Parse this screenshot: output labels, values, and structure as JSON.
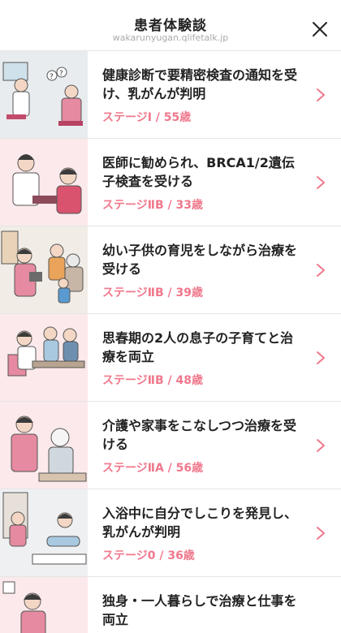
{
  "header": {
    "title": "患者体験談",
    "url": "wakarunyugan.qlifetalk.jp"
  },
  "icons": {
    "close": "close-icon",
    "chevron": "chevron-right-icon"
  },
  "colors": {
    "accent": "#f0788c"
  },
  "stories": [
    {
      "headline": "健康診断で要精密検査の通知を受け、乳がんが判明",
      "stage": "ステージI / 55歳"
    },
    {
      "headline": "医師に勧められ、BRCA1/2遺伝子検査を受ける",
      "stage": "ステージⅡB / 33歳"
    },
    {
      "headline": "幼い子供の育児をしながら治療を受ける",
      "stage": "ステージⅡB / 39歳"
    },
    {
      "headline": "思春期の2人の息子の子育てと治療を両立",
      "stage": "ステージⅡB / 48歳"
    },
    {
      "headline": "介護や家事をこなしつつ治療を受ける",
      "stage": "ステージⅡA / 56歳"
    },
    {
      "headline": "入浴中に自分でしこりを発見し、乳がんが判明",
      "stage": "ステージ0 / 36歳"
    },
    {
      "headline": "独身・一人暮らしで治療と仕事を両立",
      "stage": ""
    }
  ]
}
